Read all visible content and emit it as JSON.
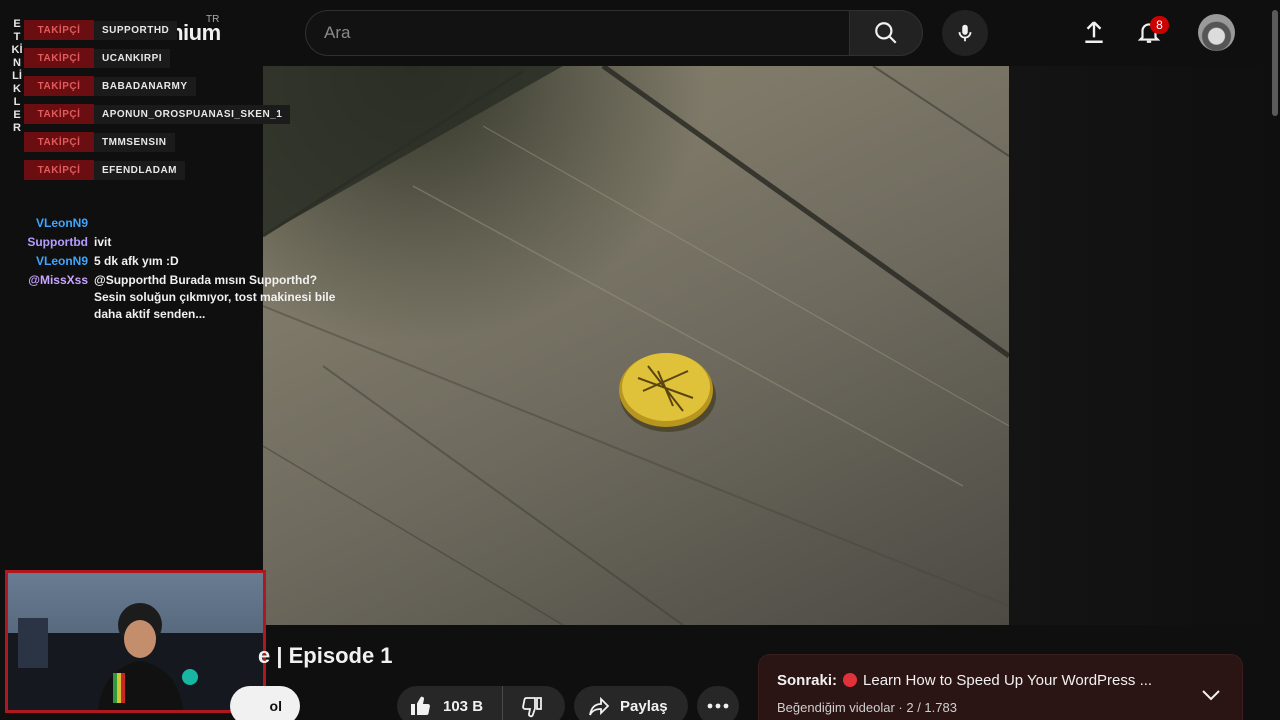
{
  "header": {
    "logo_text": "Premium",
    "logo_country": "TR",
    "search_placeholder": "Ara",
    "notification_count": "8"
  },
  "overlay": {
    "events_label": "ETKİNLİKLER",
    "follow_tag": "TAKİPÇİ",
    "followers": [
      "SUPPORTHD",
      "UCANKIRPI",
      "BABADANARMY",
      "APONUN_OROSPUANASI_SKEN_1",
      "TMMSENSIN",
      "EFENDLADAM"
    ],
    "chat": [
      {
        "user": "VLeonN9",
        "message": "",
        "color": "#3ea6ff"
      },
      {
        "user": "Supportbd",
        "message": "ivit",
        "color": "#b59cff"
      },
      {
        "user": "VLeonN9",
        "message": "5 dk afk yım :D",
        "color": "#3ea6ff"
      },
      {
        "user": "@MissXss",
        "message": "@Supporthd Burada mısın Supporthd? Sesin soluğun çıkmıyor, tost makinesi bile daha aktif senden...",
        "color": "#c9a6ff"
      }
    ]
  },
  "video": {
    "title_partial": "e | Episode 1",
    "subscribe_partial": "ol",
    "like_count": "103 B",
    "share_label": "Paylaş"
  },
  "up_next": {
    "prefix": "Sonraki:",
    "title": "Learn How to Speed Up Your WordPress ...",
    "playlist": "Beğendiğim videolar · 2 / 1.783"
  },
  "icons": {
    "search": "search-icon",
    "mic": "microphone-icon",
    "upload": "upload-icon",
    "bell": "bell-icon",
    "like": "thumbs-up-icon",
    "dislike": "thumbs-down-icon",
    "share": "share-icon",
    "more": "more-icon",
    "chevron": "chevron-down-icon"
  }
}
